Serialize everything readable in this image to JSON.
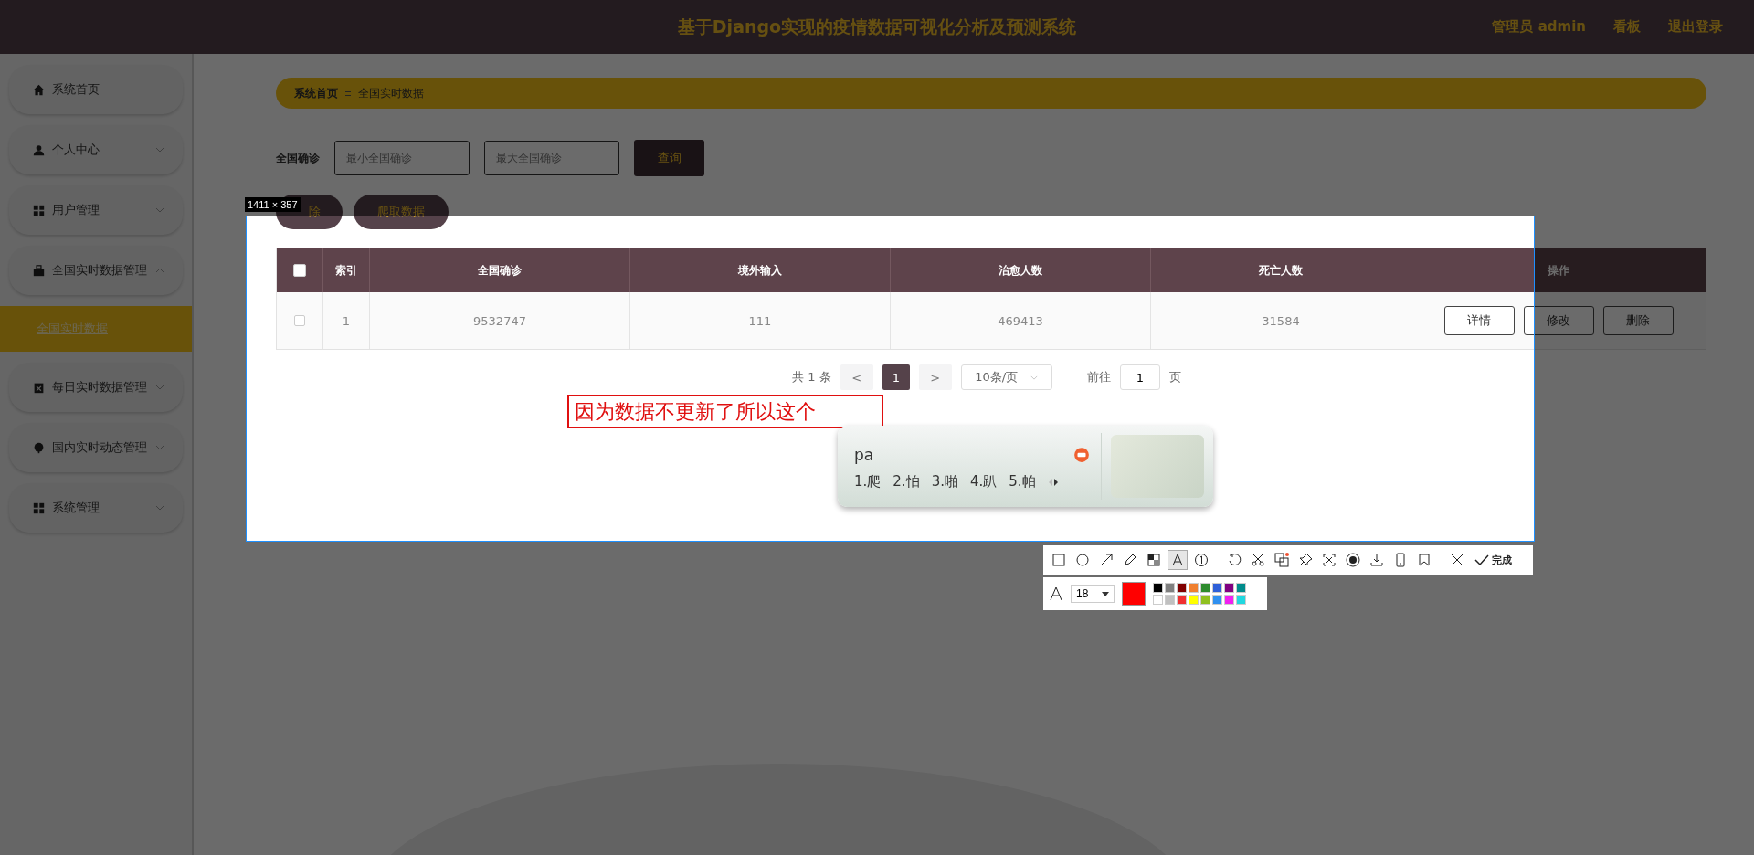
{
  "header": {
    "title": "基于Django实现的疫情数据可视化分析及预测系统",
    "user": "管理员 admin",
    "links": [
      "看板",
      "退出登录"
    ]
  },
  "sidebar": {
    "items": [
      {
        "label": "系统首页"
      },
      {
        "label": "个人中心",
        "expanded": false
      },
      {
        "label": "用户管理",
        "expanded": false
      },
      {
        "label": "全国实时数据管理",
        "expanded": true,
        "children": [
          {
            "label": "全国实时数据",
            "selected": true
          }
        ]
      },
      {
        "label": "每日实时数据管理",
        "expanded": false
      },
      {
        "label": "国内实时动态管理",
        "expanded": false
      },
      {
        "label": "系统管理",
        "expanded": false
      }
    ]
  },
  "breadcrumb": [
    "系统首页",
    "全国实时数据"
  ],
  "search": {
    "label": "全国确诊",
    "fields": [
      {
        "placeholder": "最小全国确诊"
      },
      {
        "placeholder": "最大全国确诊"
      }
    ],
    "button": "查询"
  },
  "actions": [
    "除",
    "爬取数据"
  ],
  "table": {
    "header_checked": false,
    "columns": [
      "索引",
      "全国确诊",
      "境外输入",
      "治愈人数",
      "死亡人数",
      "操作"
    ],
    "rows": [
      {
        "checked": false,
        "cells": [
          "1",
          "9532747",
          "111",
          "469413",
          "31584"
        ],
        "actions": [
          "详情",
          "修改",
          "删除"
        ]
      }
    ]
  },
  "pagination": {
    "total": "共 1 条",
    "prev": "<",
    "pages": [
      {
        "label": "1",
        "selected": true
      }
    ],
    "next": ">",
    "page_size": "10条/页",
    "goto": "前往",
    "goto_value": "1",
    "goto_suffix": "页"
  },
  "screenshot_tool": {
    "size_label": "1411 × 357",
    "annotation": "因为数据不更新了所以这个",
    "ime": {
      "input": "pa",
      "candidates": [
        "1.爬",
        "2.怕",
        "3.啪",
        "4.趴",
        "5.帕"
      ]
    },
    "tools": [
      {
        "selected": false
      },
      {
        "selected": false
      },
      {
        "selected": false
      },
      {
        "selected": false
      },
      {
        "selected": false
      },
      {
        "selected": true
      },
      {
        "selected": false
      },
      {
        "selected": false
      },
      {
        "selected": false
      },
      {
        "selected": false
      },
      {
        "selected": false
      },
      {
        "selected": false
      },
      {
        "selected": false
      },
      {
        "selected": false
      },
      {
        "selected": false
      },
      {
        "selected": false
      }
    ],
    "done": "完成",
    "font_size": "18",
    "palette": [
      {
        "kind": "current",
        "color": "#ff0000"
      },
      {
        "color": "#000000"
      },
      {
        "color": "#808080"
      },
      {
        "color": "#800000"
      },
      {
        "color": "#f08030"
      },
      {
        "color": "#2e8b2e"
      },
      {
        "color": "#2e5fd8"
      },
      {
        "color": "#800080"
      },
      {
        "color": "#008b8b"
      },
      {
        "color": "#ffffff"
      },
      {
        "color": "#c0c0c0"
      },
      {
        "color": "#f03030"
      },
      {
        "color": "#ffff00"
      },
      {
        "color": "#90c020"
      },
      {
        "color": "#3090f0"
      },
      {
        "color": "#f020f0"
      },
      {
        "color": "#20d8e0"
      }
    ]
  }
}
